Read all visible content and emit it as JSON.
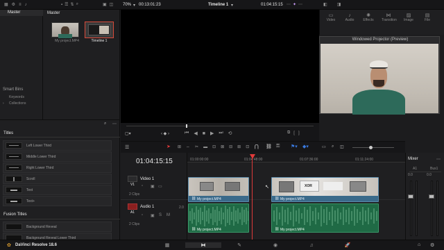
{
  "topbar": {
    "zoom": "70%",
    "timecode_left": "00:13:01:23",
    "timeline_name": "Timeline 1",
    "timecode_right": "01:04:15:15"
  },
  "media_pool": {
    "bin_label": "Master",
    "pool_label": "Master",
    "clips": [
      {
        "name": "My project.MP4"
      },
      {
        "name": "Timeline 1"
      }
    ],
    "smart_bins_label": "Smart Bins",
    "smart_bins": [
      "Keywords",
      "Collections"
    ]
  },
  "inspector_tabs": [
    "Video",
    "Audio",
    "Effects",
    "Transition",
    "Image",
    "File"
  ],
  "projector": {
    "title": "Windowed Projector (Preview)"
  },
  "effects": {
    "titles_header": "Titles",
    "titles": [
      "Left Lower Third",
      "Middle Lower Third",
      "Right Lower Third",
      "Scroll",
      "Text",
      "Text+"
    ],
    "fusion_header": "Fusion Titles",
    "fusion_titles": [
      "Background Reveal",
      "Background Reveal Lower Third"
    ]
  },
  "timeline": {
    "current_tc": "01:04:15:15",
    "ruler": [
      "01:00:00:00",
      "01:04:48:00",
      "01:07:36:00",
      "01:11:24:00"
    ],
    "tracks": {
      "video": {
        "id": "V1",
        "name": "Video 1",
        "clips": "2 Clips"
      },
      "audio": {
        "id": "A1",
        "name": "Audio 1",
        "level": "2.0",
        "clips": "2 Clips"
      }
    },
    "clips": {
      "video1": "My project.MP4",
      "video2": "My project.MP4",
      "audio1": "My project.MP4",
      "audio2": "My project.MP4"
    }
  },
  "mixer": {
    "title": "Mixer",
    "channels": [
      "A1",
      "Bus1"
    ],
    "level_a1": "0.0",
    "level_bus": "0.0"
  },
  "app": {
    "name": "DaVinci Resolve 18.6"
  },
  "colors": {
    "playhead": "#e03a3a",
    "video_clip": "#3a6a8a",
    "audio_clip": "#1f6a45",
    "selected_clip": "#d84a3a"
  }
}
